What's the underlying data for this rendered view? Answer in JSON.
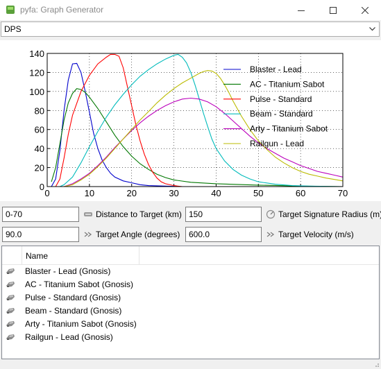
{
  "window": {
    "title": "pyfa: Graph Generator",
    "controls": [
      "minimize-icon",
      "maximize-icon",
      "close-icon"
    ]
  },
  "graph_selector": {
    "selected": "DPS"
  },
  "chart_data": {
    "type": "line",
    "xlim": [
      0,
      70
    ],
    "ylim": [
      0,
      140
    ],
    "xticks": [
      0,
      10,
      20,
      30,
      40,
      50,
      60,
      70
    ],
    "yticks": [
      0,
      20,
      40,
      60,
      80,
      100,
      120,
      140
    ],
    "grid": true,
    "legend_position": "top-right",
    "series": [
      {
        "name": "Blaster - Lead",
        "color": "#0000cc",
        "points": [
          [
            1,
            0
          ],
          [
            2,
            8
          ],
          [
            3,
            38
          ],
          [
            4,
            80
          ],
          [
            5,
            112
          ],
          [
            6,
            129
          ],
          [
            7,
            129.5
          ],
          [
            8,
            120
          ],
          [
            9,
            100
          ],
          [
            10,
            78
          ],
          [
            11,
            56
          ],
          [
            12,
            40
          ],
          [
            13,
            28
          ],
          [
            14,
            20
          ],
          [
            15,
            14
          ],
          [
            16,
            10
          ],
          [
            18,
            6
          ],
          [
            20,
            4
          ],
          [
            22,
            2
          ],
          [
            24,
            1
          ],
          [
            28,
            0.5
          ],
          [
            32,
            0
          ],
          [
            70,
            0
          ]
        ]
      },
      {
        "name": "AC - Titanium Sabot",
        "color": "#007700",
        "points": [
          [
            1,
            5
          ],
          [
            2,
            20
          ],
          [
            3,
            45
          ],
          [
            4,
            70
          ],
          [
            5,
            88
          ],
          [
            6,
            98
          ],
          [
            7,
            103
          ],
          [
            8,
            102
          ],
          [
            9,
            99
          ],
          [
            10,
            94
          ],
          [
            12,
            82
          ],
          [
            14,
            68
          ],
          [
            16,
            54
          ],
          [
            18,
            42
          ],
          [
            20,
            32
          ],
          [
            22,
            24
          ],
          [
            24,
            18
          ],
          [
            26,
            13
          ],
          [
            28,
            9.5
          ],
          [
            30,
            7
          ],
          [
            34,
            4.5
          ],
          [
            40,
            3
          ],
          [
            50,
            1.5
          ],
          [
            60,
            0.5
          ],
          [
            70,
            0
          ]
        ]
      },
      {
        "name": "Pulse - Standard",
        "color": "#ff0000",
        "points": [
          [
            2,
            0
          ],
          [
            3,
            8
          ],
          [
            4,
            30
          ],
          [
            5,
            55
          ],
          [
            6,
            75
          ],
          [
            8,
            100
          ],
          [
            10,
            117
          ],
          [
            12,
            129
          ],
          [
            14,
            136
          ],
          [
            15,
            139
          ],
          [
            16,
            139
          ],
          [
            17,
            137
          ],
          [
            18,
            125
          ],
          [
            19,
            105
          ],
          [
            20,
            85
          ],
          [
            21,
            65
          ],
          [
            22,
            48
          ],
          [
            23,
            34
          ],
          [
            24,
            23
          ],
          [
            25,
            15
          ],
          [
            26,
            9
          ],
          [
            27,
            5
          ],
          [
            28,
            3
          ],
          [
            30,
            1
          ],
          [
            32,
            0
          ],
          [
            70,
            0
          ]
        ]
      },
      {
        "name": "Beam - Standard",
        "color": "#00bbbb",
        "points": [
          [
            3,
            0
          ],
          [
            4,
            2
          ],
          [
            6,
            10
          ],
          [
            8,
            25
          ],
          [
            10,
            42
          ],
          [
            12,
            58
          ],
          [
            14,
            73
          ],
          [
            16,
            86
          ],
          [
            18,
            97
          ],
          [
            20,
            107
          ],
          [
            22,
            116
          ],
          [
            24,
            123
          ],
          [
            26,
            129
          ],
          [
            28,
            134
          ],
          [
            30,
            138
          ],
          [
            31,
            139
          ],
          [
            32,
            136
          ],
          [
            33,
            130
          ],
          [
            34,
            120
          ],
          [
            35,
            107
          ],
          [
            36,
            92
          ],
          [
            37,
            77
          ],
          [
            38,
            63
          ],
          [
            39,
            50
          ],
          [
            40,
            40
          ],
          [
            42,
            27
          ],
          [
            44,
            18
          ],
          [
            46,
            12
          ],
          [
            48,
            8
          ],
          [
            50,
            5
          ],
          [
            54,
            2.5
          ],
          [
            58,
            1
          ],
          [
            62,
            0.5
          ],
          [
            70,
            0
          ]
        ]
      },
      {
        "name": "Arty - Titanium Sabot",
        "color": "#bb00bb",
        "points": [
          [
            4,
            0
          ],
          [
            6,
            3
          ],
          [
            8,
            8
          ],
          [
            10,
            14
          ],
          [
            12,
            22
          ],
          [
            14,
            31
          ],
          [
            16,
            41
          ],
          [
            18,
            50
          ],
          [
            20,
            59
          ],
          [
            22,
            67
          ],
          [
            24,
            74
          ],
          [
            26,
            80
          ],
          [
            28,
            85
          ],
          [
            30,
            89
          ],
          [
            32,
            92
          ],
          [
            34,
            93
          ],
          [
            36,
            92
          ],
          [
            38,
            89
          ],
          [
            40,
            84
          ],
          [
            42,
            77
          ],
          [
            44,
            69
          ],
          [
            46,
            61
          ],
          [
            48,
            53
          ],
          [
            50,
            46
          ],
          [
            52,
            40
          ],
          [
            54,
            35
          ],
          [
            56,
            30
          ],
          [
            58,
            26
          ],
          [
            60,
            22
          ],
          [
            62,
            19
          ],
          [
            64,
            16
          ],
          [
            66,
            14
          ],
          [
            68,
            12
          ],
          [
            70,
            10
          ]
        ]
      },
      {
        "name": "Railgun - Lead",
        "color": "#bbbb00",
        "points": [
          [
            4,
            0
          ],
          [
            6,
            2
          ],
          [
            8,
            7
          ],
          [
            10,
            13
          ],
          [
            12,
            21
          ],
          [
            14,
            30
          ],
          [
            16,
            40
          ],
          [
            18,
            50
          ],
          [
            20,
            60
          ],
          [
            22,
            70
          ],
          [
            24,
            79
          ],
          [
            26,
            88
          ],
          [
            28,
            96
          ],
          [
            30,
            103
          ],
          [
            32,
            109
          ],
          [
            34,
            114
          ],
          [
            36,
            119
          ],
          [
            37,
            121
          ],
          [
            38,
            122
          ],
          [
            39,
            121.5
          ],
          [
            40,
            119
          ],
          [
            41,
            114
          ],
          [
            42,
            107
          ],
          [
            43,
            99
          ],
          [
            44,
            90
          ],
          [
            46,
            74
          ],
          [
            48,
            60
          ],
          [
            50,
            48
          ],
          [
            52,
            39
          ],
          [
            54,
            31
          ],
          [
            56,
            25
          ],
          [
            58,
            20
          ],
          [
            60,
            16
          ],
          [
            62,
            13
          ],
          [
            64,
            11
          ],
          [
            66,
            9
          ],
          [
            68,
            7.5
          ],
          [
            70,
            6
          ]
        ]
      }
    ]
  },
  "params": {
    "distance": {
      "value": "0-70",
      "label": "Distance to Target (km)"
    },
    "signature": {
      "value": "150",
      "label": "Target Signature Radius (m)"
    },
    "angle": {
      "value": "90.0",
      "label": "Target Angle (degrees)"
    },
    "velocity": {
      "value": "600.0",
      "label": "Target Velocity (m/s)"
    }
  },
  "fit_list": {
    "column_header": "Name",
    "items": [
      "Blaster - Lead (Gnosis)",
      "AC - Titanium Sabot (Gnosis)",
      "Pulse - Standard (Gnosis)",
      "Beam - Standard (Gnosis)",
      "Arty - Titanium Sabot (Gnosis)",
      "Railgun - Lead (Gnosis)"
    ]
  }
}
